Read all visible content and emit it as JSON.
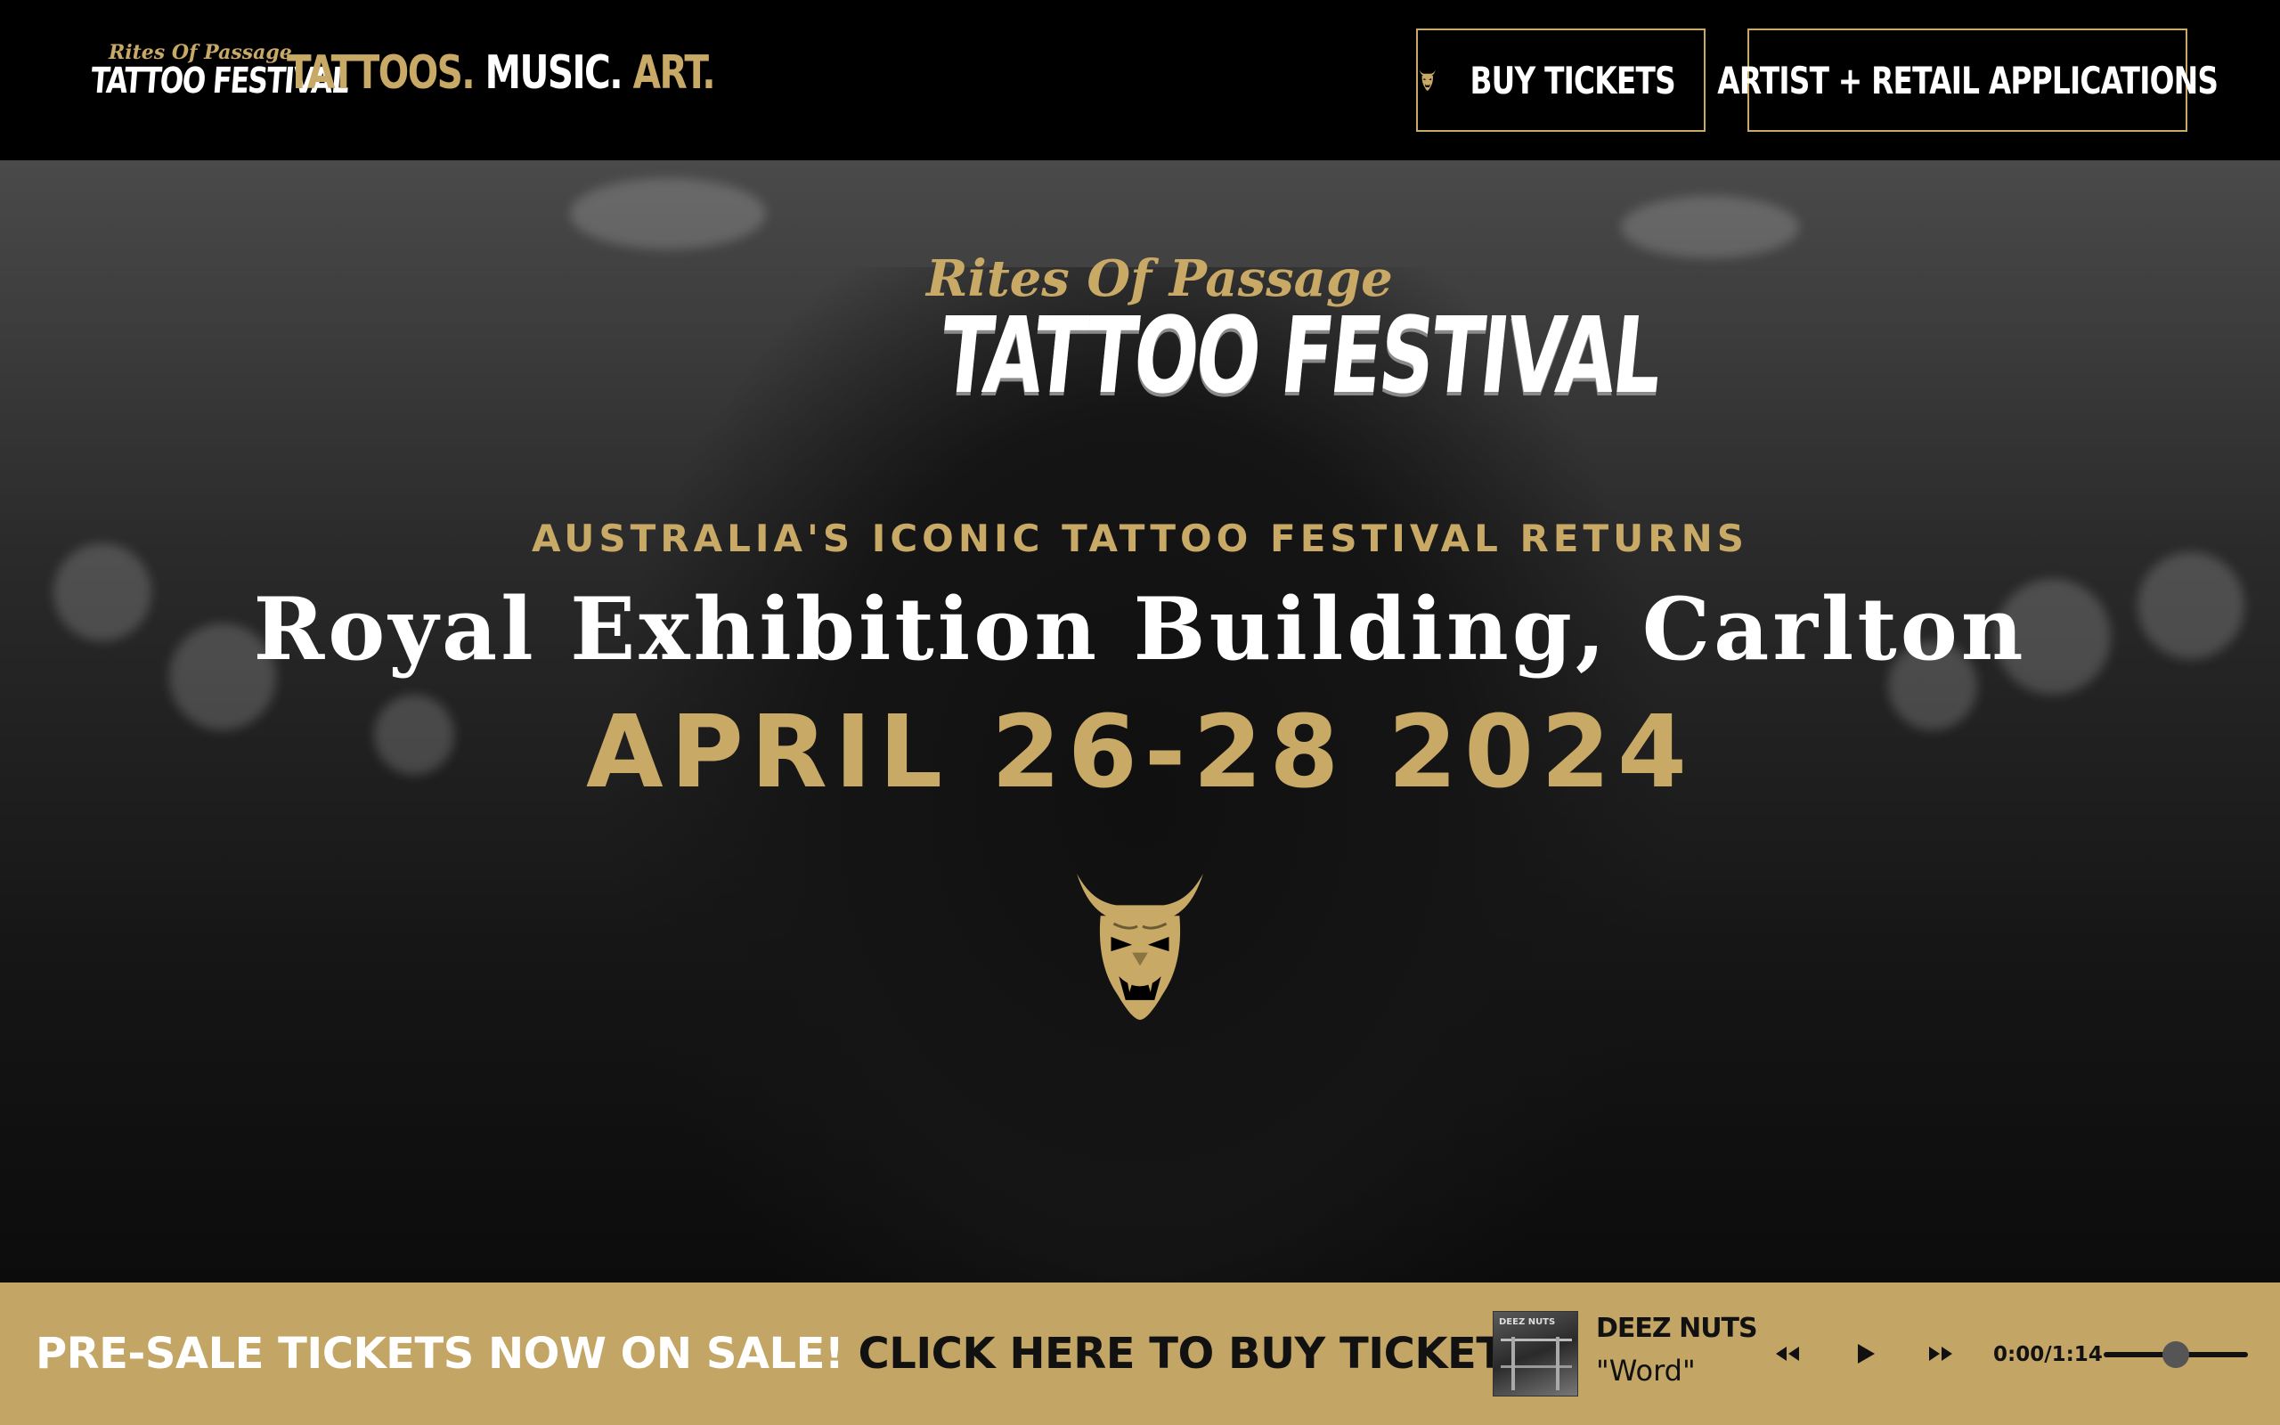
{
  "colors": {
    "gold": "#c8a965",
    "banner_gold": "#c3a565",
    "black": "#000000",
    "white": "#ffffff"
  },
  "header": {
    "logo": {
      "top_line": "Rites Of Passage",
      "main_line": "TATTOO FESTIVAL"
    },
    "tagline": {
      "part1": "TATTOOS.",
      "part2": " MUSIC.",
      "part3": " ART."
    },
    "buy_tickets_label": "BUY TICKETS",
    "buy_tickets_icon": "oni-mask-icon",
    "applications_label": "ARTIST + RETAIL APPLICATIONS"
  },
  "hero": {
    "logo": {
      "top_line": "Rites Of Passage",
      "main_line": "TATTOO FESTIVAL"
    },
    "subtitle": "AUSTRALIA'S ICONIC TATTOO FESTIVAL RETURNS",
    "venue": "Royal Exhibition Building, Carlton",
    "dates": "APRIL 26-28 2024",
    "emblem_icon": "oni-mask-icon"
  },
  "banner": {
    "promo_text": "PRE-SALE TICKETS NOW ON SALE!",
    "promo_link": " CLICK HERE TO BUY TICKETS"
  },
  "player": {
    "album_text": "DEEZ NUTS",
    "artist": "DEEZ NUTS",
    "track": "\"Word\"",
    "time": "0:00/1:14",
    "progress_fraction": 0.0,
    "volume_fraction": 0.5,
    "icons": [
      "rewind-icon",
      "play-icon",
      "fast-forward-icon"
    ]
  }
}
